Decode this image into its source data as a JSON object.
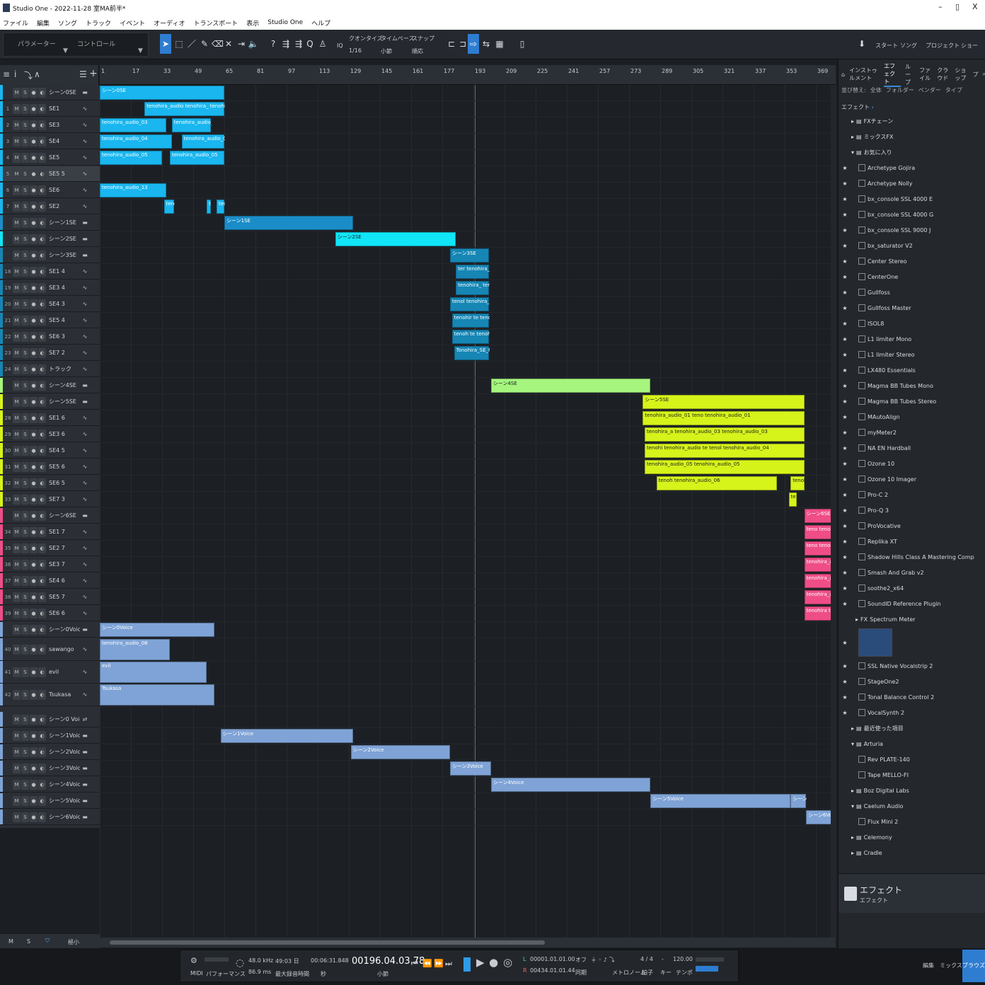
{
  "window": {
    "title": "Studio One - 2022-11-28 室MA前半*",
    "min": "–",
    "max": "▯",
    "close": "X"
  },
  "menu": [
    "ファイル",
    "編集",
    "ソング",
    "トラック",
    "イベント",
    "オーディオ",
    "トランスポート",
    "表示",
    "Studio One",
    "ヘルプ"
  ],
  "toolbar": {
    "param_label": "パラメーター",
    "control_label": "コントロール",
    "quantize_label": "クオンタイズ",
    "quantize_value": "1/16",
    "timebase_label": "タイムベース",
    "timebase_value": "小節",
    "snap_label": "スナップ",
    "snap_value": "順応",
    "iq": "IQ",
    "start": "スタート",
    "song": "ソング",
    "project": "プロジェクト",
    "show": "ショー"
  },
  "ruler": [
    "1",
    "17",
    "33",
    "49",
    "65",
    "81",
    "97",
    "113",
    "129",
    "145",
    "161",
    "177",
    "193",
    "209",
    "225",
    "241",
    "257",
    "273",
    "289",
    "305",
    "321",
    "337",
    "353",
    "369"
  ],
  "colors": {
    "cyan": "#19b6ef",
    "blue": "#1a8dc8",
    "aqua": "#10e6f7",
    "teal": "#1686b5",
    "green": "#a6f57e",
    "yellow": "#d6f31a",
    "pink": "#ef4d86",
    "voice": "#7fa3d6"
  },
  "tracks": [
    {
      "num": "",
      "name": "シーン0SE",
      "color": "cyan",
      "type": "folder"
    },
    {
      "num": "1",
      "name": "SE1",
      "color": "cyan",
      "type": "audio"
    },
    {
      "num": "2",
      "name": "SE3",
      "color": "cyan",
      "type": "audio"
    },
    {
      "num": "3",
      "name": "SE4",
      "color": "cyan",
      "type": "audio"
    },
    {
      "num": "4",
      "name": "SE5",
      "color": "cyan",
      "type": "audio"
    },
    {
      "num": "5",
      "name": "SE5 5",
      "color": "cyan",
      "type": "audio"
    },
    {
      "num": "6",
      "name": "SE6",
      "color": "cyan",
      "type": "audio"
    },
    {
      "num": "7",
      "name": "SE2",
      "color": "cyan",
      "type": "audio"
    },
    {
      "num": "",
      "name": "シーン1SE",
      "color": "blue",
      "type": "folder"
    },
    {
      "num": "",
      "name": "シーン2SE",
      "color": "aqua",
      "type": "folder"
    },
    {
      "num": "",
      "name": "シーン3SE",
      "color": "teal",
      "type": "folder"
    },
    {
      "num": "18",
      "name": "SE1 4",
      "color": "teal",
      "type": "audio"
    },
    {
      "num": "19",
      "name": "SE3 4",
      "color": "teal",
      "type": "audio"
    },
    {
      "num": "20",
      "name": "SE4 3",
      "color": "teal",
      "type": "audio"
    },
    {
      "num": "21",
      "name": "SE5 4",
      "color": "teal",
      "type": "audio"
    },
    {
      "num": "22",
      "name": "SE6 3",
      "color": "teal",
      "type": "audio"
    },
    {
      "num": "23",
      "name": "SE7 2",
      "color": "teal",
      "type": "audio"
    },
    {
      "num": "24",
      "name": "トラック",
      "color": "teal",
      "type": "audio"
    },
    {
      "num": "",
      "name": "シーン4SE",
      "color": "green",
      "type": "folder"
    },
    {
      "num": "",
      "name": "シーン5SE",
      "color": "yellow",
      "type": "folder"
    },
    {
      "num": "28",
      "name": "SE1 6",
      "color": "yellow",
      "type": "audio"
    },
    {
      "num": "29",
      "name": "SE3 6",
      "color": "yellow",
      "type": "audio"
    },
    {
      "num": "30",
      "name": "SE4 5",
      "color": "yellow",
      "type": "audio"
    },
    {
      "num": "31",
      "name": "SE5 6",
      "color": "yellow",
      "type": "audio"
    },
    {
      "num": "32",
      "name": "SE6 5",
      "color": "yellow",
      "type": "audio"
    },
    {
      "num": "33",
      "name": "SE7 3",
      "color": "yellow",
      "type": "audio"
    },
    {
      "num": "",
      "name": "シーン6SE",
      "color": "pink",
      "type": "folder"
    },
    {
      "num": "34",
      "name": "SE1 7",
      "color": "pink",
      "type": "audio"
    },
    {
      "num": "35",
      "name": "SE2 7",
      "color": "pink",
      "type": "audio"
    },
    {
      "num": "36",
      "name": "SE3 7",
      "color": "pink",
      "type": "audio"
    },
    {
      "num": "37",
      "name": "SE4 6",
      "color": "pink",
      "type": "audio"
    },
    {
      "num": "38",
      "name": "SE5 7",
      "color": "pink",
      "type": "audio"
    },
    {
      "num": "39",
      "name": "SE6 6",
      "color": "pink",
      "type": "audio"
    },
    {
      "num": "",
      "name": "シーン0Voice",
      "color": "voice",
      "type": "folder"
    },
    {
      "num": "40",
      "name": "sawango",
      "color": "voice",
      "type": "audio"
    },
    {
      "num": "41",
      "name": "evil",
      "color": "voice",
      "type": "audio"
    },
    {
      "num": "42",
      "name": "Tsukasa",
      "color": "voice",
      "type": "audio"
    },
    {
      "num": "",
      "name": "シーン0 Voice",
      "color": "voice",
      "type": "bus"
    },
    {
      "num": "",
      "name": "シーン1Voice",
      "color": "voice",
      "type": "folder"
    },
    {
      "num": "",
      "name": "シーン2Voice",
      "color": "voice",
      "type": "folder"
    },
    {
      "num": "",
      "name": "シーン3Voice",
      "color": "voice",
      "type": "folder"
    },
    {
      "num": "",
      "name": "シーン4Voice",
      "color": "voice",
      "type": "folder"
    },
    {
      "num": "",
      "name": "シーン5Voice",
      "color": "voice",
      "type": "folder"
    },
    {
      "num": "",
      "name": "シーン6Voice",
      "color": "voice",
      "type": "folder"
    }
  ],
  "clips": [
    {
      "row": 0,
      "start": 1,
      "end": 65,
      "label": "シーン0SE",
      "color": "cyan"
    },
    {
      "row": 1,
      "start": 24,
      "end": 65,
      "label": "tenohira_audio tenohira_ tenohira_audio_0",
      "color": "cyan"
    },
    {
      "row": 2,
      "start": 1,
      "end": 35,
      "label": "tenohira_audio_03",
      "color": "cyan"
    },
    {
      "row": 2,
      "start": 38,
      "end": 58,
      "label": "tenohira_audio_0",
      "color": "cyan"
    },
    {
      "row": 3,
      "start": 1,
      "end": 38,
      "label": "tenohira_audio_04",
      "color": "cyan"
    },
    {
      "row": 3,
      "start": 43,
      "end": 65,
      "label": "tenohira_audio_04",
      "color": "cyan"
    },
    {
      "row": 4,
      "start": 1,
      "end": 33,
      "label": "tenohira_audio_05",
      "color": "cyan"
    },
    {
      "row": 4,
      "start": 37,
      "end": 65,
      "label": "tenohira_audio_05",
      "color": "cyan"
    },
    {
      "row": 6,
      "start": 1,
      "end": 35,
      "label": "tenohira_audio_13",
      "color": "cyan"
    },
    {
      "row": 7,
      "start": 34,
      "end": 39,
      "label": "teno",
      "color": "cyan"
    },
    {
      "row": 7,
      "start": 56,
      "end": 58,
      "label": "t",
      "color": "cyan"
    },
    {
      "row": 7,
      "start": 61,
      "end": 65,
      "label": "tec",
      "color": "cyan"
    },
    {
      "row": 8,
      "start": 65,
      "end": 131,
      "label": "シーン1SE",
      "color": "blue"
    },
    {
      "row": 9,
      "start": 122,
      "end": 184,
      "label": "シーン2SE",
      "color": "aqua"
    },
    {
      "row": 10,
      "start": 181,
      "end": 201,
      "label": "シーン3SE",
      "color": "teal"
    },
    {
      "row": 11,
      "start": 184,
      "end": 201,
      "label": "ter tenohira_audio",
      "color": "teal"
    },
    {
      "row": 12,
      "start": 184,
      "end": 201,
      "label": "tenohira_ tenohira",
      "color": "teal"
    },
    {
      "row": 13,
      "start": 181,
      "end": 201,
      "label": "tenol tenohira_audio",
      "color": "teal"
    },
    {
      "row": 14,
      "start": 182,
      "end": 201,
      "label": "tenohir te tenohira_",
      "color": "teal"
    },
    {
      "row": 15,
      "start": 182,
      "end": 201,
      "label": "tenoh te tenohira_",
      "color": "teal"
    },
    {
      "row": 16,
      "start": 183,
      "end": 201,
      "label": "Tonohira_SE_Rzd",
      "color": "teal"
    },
    {
      "row": 18,
      "start": 202,
      "end": 284,
      "label": "シーン4SE",
      "color": "green"
    },
    {
      "row": 19,
      "start": 280,
      "end": 363,
      "label": "シーン5SE",
      "color": "yellow"
    },
    {
      "row": 20,
      "start": 280,
      "end": 363,
      "label": "tenohira_audio_01  teno tenohira_audio_01",
      "color": "yellow"
    },
    {
      "row": 21,
      "start": 281,
      "end": 363,
      "label": "tenohira_a tenohira_audio_03 tenohira_audio_03",
      "color": "yellow"
    },
    {
      "row": 22,
      "start": 281,
      "end": 363,
      "label": "tenohi tenohira_audio te tenol tenohira_audio_04",
      "color": "yellow"
    },
    {
      "row": 23,
      "start": 281,
      "end": 363,
      "label": "tenohira_audio_05 tenohira_audio_05",
      "color": "yellow"
    },
    {
      "row": 24,
      "start": 287,
      "end": 349,
      "label": "tenoh tenohira_audio_06",
      "color": "yellow"
    },
    {
      "row": 24,
      "start": 356,
      "end": 363,
      "label": "tenohira",
      "color": "yellow"
    },
    {
      "row": 25,
      "start": 355,
      "end": 359,
      "label": "te",
      "color": "yellow"
    },
    {
      "row": 26,
      "start": 363,
      "end": 377,
      "label": "シーン6SE",
      "color": "pink"
    },
    {
      "row": 27,
      "start": 363,
      "end": 377,
      "label": "teno tenohira",
      "color": "pink"
    },
    {
      "row": 28,
      "start": 363,
      "end": 377,
      "label": "teno tenohira",
      "color": "pink"
    },
    {
      "row": 29,
      "start": 363,
      "end": 377,
      "label": "tenohira_aud",
      "color": "pink"
    },
    {
      "row": 30,
      "start": 363,
      "end": 377,
      "label": "tenohira_a t",
      "color": "pink"
    },
    {
      "row": 31,
      "start": 363,
      "end": 377,
      "label": "tenohira_aud",
      "color": "pink"
    },
    {
      "row": 32,
      "start": 363,
      "end": 377,
      "label": "tenohira teno",
      "color": "pink"
    },
    {
      "row": 33,
      "start": 1,
      "end": 60,
      "label": "シーン0Voice",
      "color": "voice"
    },
    {
      "row": 34,
      "start": 1,
      "end": 37,
      "label": "tenohira_audio_08",
      "color": "voice"
    },
    {
      "row": 35,
      "start": 1,
      "end": 56,
      "label": "evil",
      "color": "voice"
    },
    {
      "row": 36,
      "start": 1,
      "end": 60,
      "label": "Tsukasa",
      "color": "voice"
    },
    {
      "row": 38,
      "start": 63,
      "end": 131,
      "label": "シーン1Voice",
      "color": "voice"
    },
    {
      "row": 39,
      "start": 130,
      "end": 181,
      "label": "シーン2Voice",
      "color": "voice"
    },
    {
      "row": 40,
      "start": 181,
      "end": 202,
      "label": "シーン3Voice",
      "color": "voice"
    },
    {
      "row": 41,
      "start": 202,
      "end": 284,
      "label": "シーン4Voice",
      "color": "voice"
    },
    {
      "row": 42,
      "start": 284,
      "end": 356,
      "label": "シーン5Voice",
      "color": "voice"
    },
    {
      "row": 42,
      "start": 356,
      "end": 364,
      "label": "シーン5",
      "color": "voice"
    },
    {
      "row": 43,
      "start": 364,
      "end": 377,
      "label": "シーン6Voice",
      "color": "voice"
    }
  ],
  "browser": {
    "tabs": [
      "インストゥルメント",
      "エフェクト",
      "ループ",
      "ファイル",
      "クラウド",
      "ショップ",
      "プ"
    ],
    "filter": {
      "label": "並び替え:",
      "opts": [
        "全体",
        "フォルダー",
        "ベンダー",
        "タイプ"
      ]
    },
    "path": "エフェクト",
    "items": [
      {
        "name": "FXチェーン",
        "kind": "folder"
      },
      {
        "name": "ミックスFX",
        "kind": "folder"
      },
      {
        "name": "お気に入り",
        "kind": "folder-open"
      },
      {
        "name": "Archetype Gojira",
        "kind": "fav"
      },
      {
        "name": "Archetype Nolly",
        "kind": "fav"
      },
      {
        "name": "bx_console SSL 4000 E",
        "kind": "fav"
      },
      {
        "name": "bx_console SSL 4000 G",
        "kind": "fav"
      },
      {
        "name": "bx_console SSL 9000 J",
        "kind": "fav"
      },
      {
        "name": "bx_saturator V2",
        "kind": "fav"
      },
      {
        "name": "Center Stereo",
        "kind": "fav"
      },
      {
        "name": "CenterOne",
        "kind": "fav"
      },
      {
        "name": "Gullfoss",
        "kind": "fav"
      },
      {
        "name": "Gullfoss Master",
        "kind": "fav"
      },
      {
        "name": "ISOL8",
        "kind": "fav"
      },
      {
        "name": "L1 limiter Mono",
        "kind": "fav"
      },
      {
        "name": "L1 limiter Stereo",
        "kind": "fav"
      },
      {
        "name": "LX480 Essentials",
        "kind": "fav"
      },
      {
        "name": "Magma BB Tubes Mono",
        "kind": "fav"
      },
      {
        "name": "Magma BB Tubes Stereo",
        "kind": "fav"
      },
      {
        "name": "MAutoAlign",
        "kind": "fav"
      },
      {
        "name": "myMeter2",
        "kind": "fav"
      },
      {
        "name": "NA EN Hardball",
        "kind": "fav"
      },
      {
        "name": "Ozone 10",
        "kind": "fav"
      },
      {
        "name": "Ozone 10 Imager",
        "kind": "fav"
      },
      {
        "name": "Pro-C 2",
        "kind": "fav"
      },
      {
        "name": "Pro-Q 3",
        "kind": "fav"
      },
      {
        "name": "ProVocative",
        "kind": "fav"
      },
      {
        "name": "Replika XT",
        "kind": "fav"
      },
      {
        "name": "Shadow Hills Class A Mastering Comp",
        "kind": "fav"
      },
      {
        "name": "Smash And Grab v2",
        "kind": "fav"
      },
      {
        "name": "soothe2_x64",
        "kind": "fav"
      },
      {
        "name": "SoundID Reference Plugin",
        "kind": "fav"
      },
      {
        "name": "Spectrum Meter",
        "kind": "sub"
      },
      {
        "name": "",
        "kind": "preview"
      },
      {
        "name": "SSL Native Vocalstrip 2",
        "kind": "fav"
      },
      {
        "name": "StageOne2",
        "kind": "fav"
      },
      {
        "name": "Tonal Balance Control 2",
        "kind": "fav"
      },
      {
        "name": "VocalSynth 2",
        "kind": "fav"
      },
      {
        "name": "最近使った項目",
        "kind": "folder"
      },
      {
        "name": "Arturia",
        "kind": "folder-open"
      },
      {
        "name": "Rev PLATE-140",
        "kind": "plugin"
      },
      {
        "name": "Tape MELLO-FI",
        "kind": "plugin"
      },
      {
        "name": "Boz Digital Labs",
        "kind": "folder"
      },
      {
        "name": "Caelum Audio",
        "kind": "folder-open"
      },
      {
        "name": "Flux Mini 2",
        "kind": "plugin"
      },
      {
        "name": "Celemony",
        "kind": "folder"
      },
      {
        "name": "Cradle",
        "kind": "folder"
      }
    ],
    "footer_title": "エフェクト",
    "footer_sub": "エフェクト"
  },
  "left_footer": {
    "m": "M",
    "s": "S",
    "zoom": "極小"
  },
  "transport": {
    "midi": "MIDI",
    "perf": "パフォーマンス",
    "rate": "48.0 kHz",
    "lat": "86.9 ms",
    "rec_time": "49:03 日",
    "rec_label": "最大録音時間",
    "time": "00:06:31.848",
    "time_label": "秒",
    "bars": "00196.04.03.78",
    "bars_label": "小節",
    "L": "00001.01.01.00",
    "R": "00434.01.01.44",
    "off": "オフ",
    "sync": "同期",
    "metro": "メトロノーム",
    "sig": "4 / 4",
    "sig_label": "拍子",
    "key": "-",
    "key_label": "キー",
    "tempo": "120.00",
    "tempo_label": "テンポ"
  },
  "bottom_right": {
    "edit": "編集",
    "mix": "ミックス",
    "browse": "ブラウズ"
  }
}
